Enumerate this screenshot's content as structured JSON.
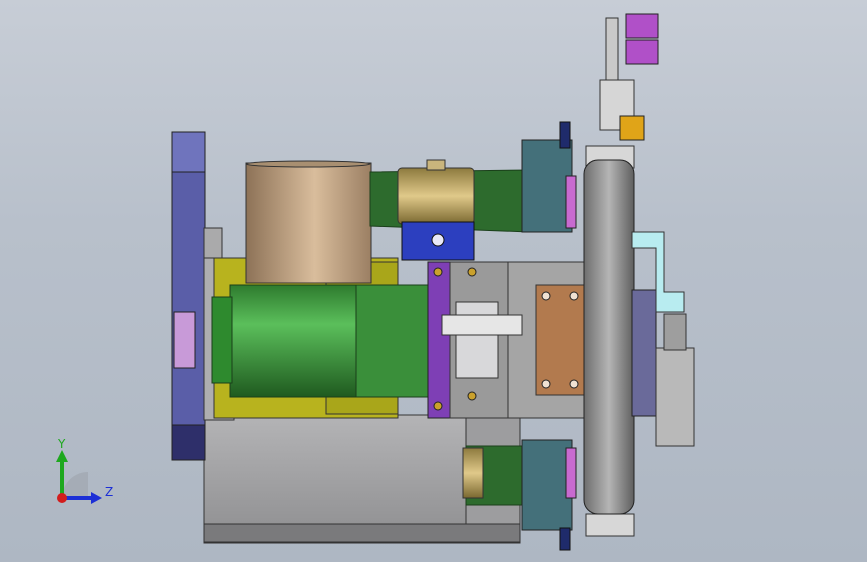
{
  "viewport": {
    "background": "#bcc3ce",
    "triad": {
      "y_label": "Y",
      "z_label": "Z",
      "y_color": "#1ea81e",
      "z_color": "#1c2fd6",
      "origin_color": "#d21c1c"
    }
  },
  "model": {
    "parts": [
      {
        "name": "base-plate",
        "color": "#a4a4a6"
      },
      {
        "name": "left-flange-plate",
        "color": "#5a5ea8"
      },
      {
        "name": "pulley-cylinder",
        "color": "#c3a587"
      },
      {
        "name": "motor-body",
        "color": "#3f9c3f"
      },
      {
        "name": "motor-mount-bracket",
        "color": "#b8b31e"
      },
      {
        "name": "coupling-housing",
        "color": "#9a9a9a"
      },
      {
        "name": "bearing-block",
        "color": "#b27a4e"
      },
      {
        "name": "turntable-disc",
        "color": "#8c8c8c"
      },
      {
        "name": "cylinder-valve-top",
        "color": "#b050c8"
      },
      {
        "name": "side-bracket-purple",
        "color": "#7e3fb5"
      },
      {
        "name": "belt",
        "color": "#2d6b2d"
      },
      {
        "name": "idler-pulley",
        "color": "#bda05a"
      },
      {
        "name": "mount-block-blue",
        "color": "#2c3fbf"
      },
      {
        "name": "guide-block-teal",
        "color": "#44707a"
      }
    ]
  }
}
